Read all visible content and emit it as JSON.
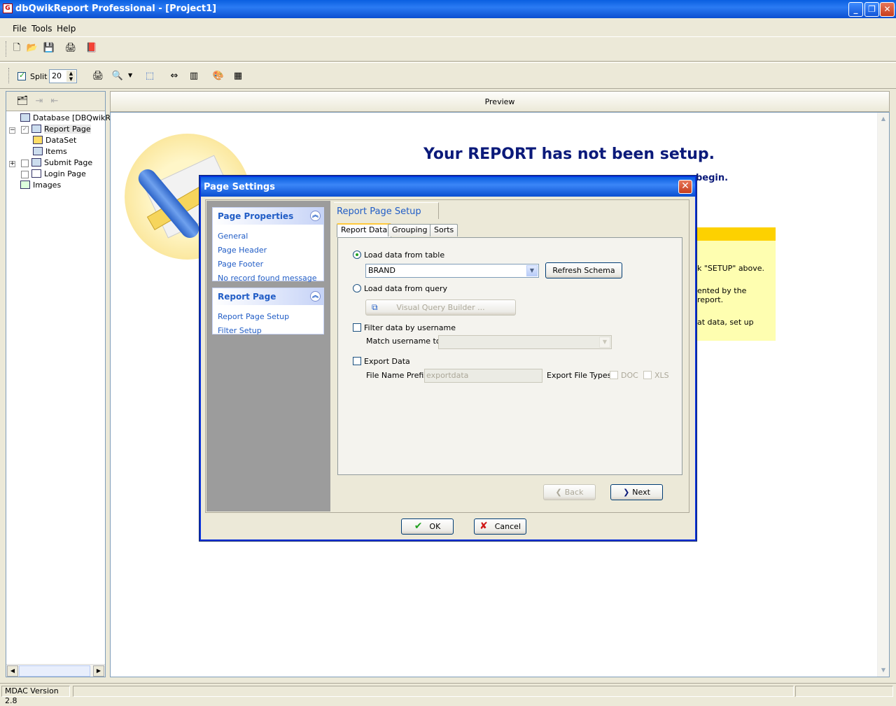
{
  "window": {
    "title": "dbQwikReport Professional - [Project1]",
    "minimize_icon": "minimize-icon",
    "restore_icon": "restore-icon",
    "close_icon": "close-icon"
  },
  "menu": [
    "File",
    "Tools",
    "Help"
  ],
  "toolbar2": {
    "split_label": "Split",
    "split_value": "20"
  },
  "tree": {
    "items": [
      "Database [DBQwikRe",
      "Report Page",
      "DataSet",
      "Items",
      "Submit Page",
      "Login Page",
      "Images"
    ]
  },
  "preview": {
    "header": "Preview",
    "headline": "Your REPORT has not been setup.",
    "subline_fragment": "begin.",
    "note_lines": [
      "k \"SETUP\" above.",
      "ented by the",
      "report.",
      "at data, set up"
    ]
  },
  "status": {
    "mdac": "MDAC Version 2.8"
  },
  "dialog": {
    "title": "Page Settings",
    "groups": [
      {
        "title": "Page Properties",
        "links": [
          "General",
          "Page Header",
          "Page Footer",
          "No record found message"
        ]
      },
      {
        "title": "Report Page",
        "links": [
          "Report Page Setup",
          "Filter Setup"
        ]
      }
    ],
    "panel_title": "Report Page Setup",
    "tabs": [
      "Report Data",
      "Grouping",
      "Sorts"
    ],
    "load_table_label": "Load data from table",
    "table_value": "BRAND",
    "refresh_schema": "Refresh Schema",
    "load_query_label": "Load data from query",
    "vqb_label": "Visual Query Builder ...",
    "filter_username_label": "Filter data by username",
    "match_username_label": "Match username to:",
    "export_label": "Export Data",
    "file_prefix_label": "File Name Prefix:",
    "file_prefix_placeholder": "exportdata",
    "export_types_label": "Export File Types:",
    "doc_label": "DOC",
    "xls_label": "XLS",
    "back": "Back",
    "next": "Next",
    "ok": "OK",
    "cancel": "Cancel"
  },
  "colors": {
    "title_blue": "#0a5fe0",
    "link_blue": "#215dc6",
    "headline": "#0b1a7a",
    "sticky": "#fefeb0",
    "sticky_bar": "#fdd100"
  }
}
